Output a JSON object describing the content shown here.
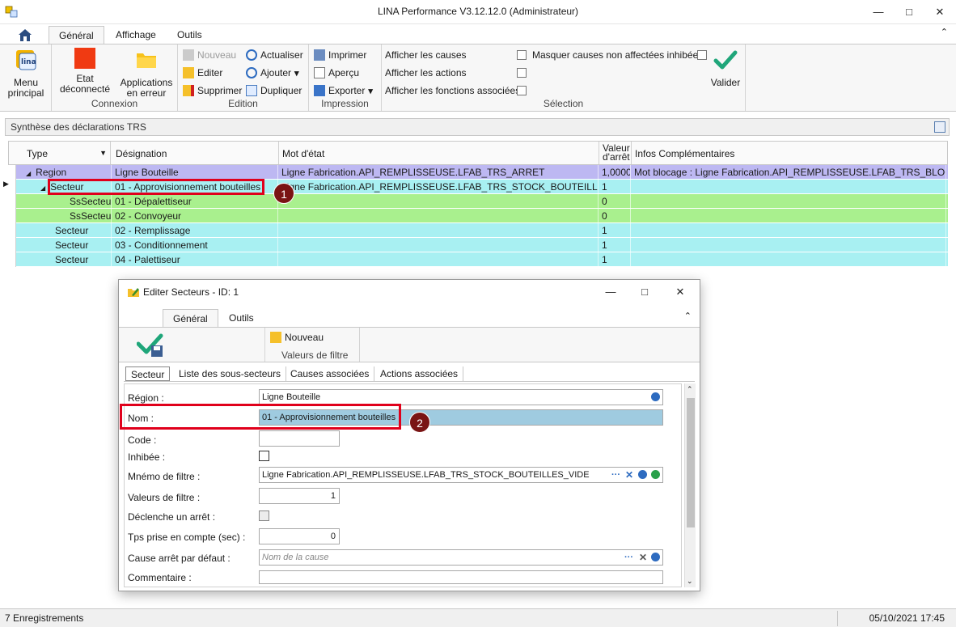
{
  "window": {
    "title": "LINA Performance  V3.12.12.0  (Administrateur)"
  },
  "ribbon_tabs": [
    "Général",
    "Affichage",
    "Outils"
  ],
  "ribbon": {
    "menu_principal": "Menu principal",
    "etat": "Etat déconnecté",
    "applications": "Applications en erreur",
    "connexion_label": "Connexion",
    "nouveau": "Nouveau",
    "editer": "Editer",
    "supprimer": "Supprimer",
    "actualiser": "Actualiser",
    "ajouter": "Ajouter",
    "dupliquer": "Dupliquer",
    "edition_label": "Edition",
    "imprimer": "Imprimer",
    "apercu": "Aperçu",
    "exporter": "Exporter",
    "impression_label": "Impression",
    "afficher_causes": "Afficher les causes",
    "afficher_actions": "Afficher les actions",
    "afficher_fonctions": "Afficher les fonctions associées",
    "masquer_causes": "Masquer causes non affectées inhibées",
    "valider": "Valider",
    "selection_label": "Sélection"
  },
  "panel": {
    "title": "Synthèse des déclarations TRS"
  },
  "grid": {
    "headers": {
      "type": "Type",
      "designation": "Désignation",
      "mot_etat": "Mot d'état",
      "valeur_arret": "Valeur d'arrêt",
      "infos": "Infos Complémentaires"
    },
    "rows": [
      {
        "type": "Region",
        "designation": "Ligne Bouteille",
        "mot": "Ligne Fabrication.API_REMPLISSEUSE.LFAB_TRS_ARRET",
        "valeur": "1,0000",
        "infos": "Mot blocage : Ligne Fabrication.API_REMPLISSEUSE.LFAB_TRS_BLOCAGE..."
      },
      {
        "type": "Secteur",
        "designation": "01 - Approvisionnement bouteilles",
        "mot": "Ligne Fabrication.API_REMPLISSEUSE.LFAB_TRS_STOCK_BOUTEILLES_VIDE",
        "valeur": "1",
        "infos": ""
      },
      {
        "type": "SsSecteur",
        "designation": "01 - Dépalettiseur",
        "mot": "",
        "valeur": "0",
        "infos": ""
      },
      {
        "type": "SsSecteur",
        "designation": "02 - Convoyeur",
        "mot": "",
        "valeur": "0",
        "infos": ""
      },
      {
        "type": "Secteur",
        "designation": "02 - Remplissage",
        "mot": "",
        "valeur": "1",
        "infos": ""
      },
      {
        "type": "Secteur",
        "designation": "03 - Conditionnement",
        "mot": "",
        "valeur": "1",
        "infos": ""
      },
      {
        "type": "Secteur",
        "designation": "04 - Palettiseur",
        "mot": "",
        "valeur": "1",
        "infos": ""
      }
    ]
  },
  "dialog": {
    "title": "Editer Secteurs - ID: 1",
    "tabs": [
      "Général",
      "Outils"
    ],
    "nouveau": "Nouveau",
    "valeurs_filtre_group": "Valeurs de filtre",
    "subtabs": [
      "Secteur",
      "Liste des sous-secteurs",
      "Causes associées",
      "Actions associées"
    ],
    "fields": {
      "region_label": "Région :",
      "region_value": "Ligne Bouteille",
      "nom_label": "Nom :",
      "nom_value": "01 - Approvisionnement bouteilles",
      "code_label": "Code :",
      "inhibee_label": "Inhibée :",
      "mnemo_label": "Mnémo de filtre :",
      "mnemo_value": "Ligne Fabrication.API_REMPLISSEUSE.LFAB_TRS_STOCK_BOUTEILLES_VIDE",
      "valeurs_label": "Valeurs de filtre :",
      "valeurs_value": "1",
      "declenche_label": "Déclenche un arrêt :",
      "tps_label": "Tps prise en compte (sec) :",
      "tps_value": "0",
      "cause_label": "Cause arrêt par défaut :",
      "cause_placeholder": "Nom de la cause",
      "commentaire_label": "Commentaire :"
    }
  },
  "badges": [
    "1",
    "2"
  ],
  "status": {
    "left": "7 Enregistrements",
    "right": "05/10/2021 17:45"
  },
  "colors": {
    "row_region": "#bdb8f2",
    "row_secteur": "#a8f0f2",
    "row_sssecteur": "#a9f08e",
    "highlight_red": "#e0001b",
    "accent_check": "#1fa67a"
  }
}
